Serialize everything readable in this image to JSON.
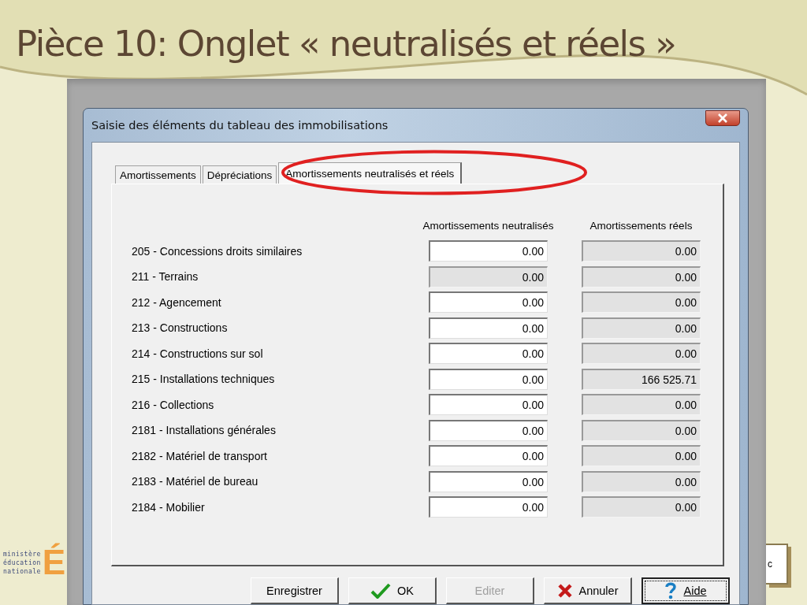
{
  "slide": {
    "title": "Pièce 10: Onglet « neutralisés et réels »",
    "logo": {
      "mark": "É",
      "lines": [
        "ministère",
        "éducation",
        "nationale"
      ]
    },
    "background_window": {
      "text": "c"
    }
  },
  "dialog": {
    "title": "Saisie des éléments du tableau des immobilisations",
    "tabs": [
      {
        "label": "Amortissements",
        "selected": false
      },
      {
        "label": "Dépréciations",
        "selected": false
      },
      {
        "label": "Amortissements neutralisés et réels",
        "selected": true
      }
    ],
    "columns": [
      "Amortissements neutralisés",
      "Amortissements réels"
    ],
    "rows": [
      {
        "label": "205 - Concessions droits similaires",
        "neutralises": {
          "value": "0.00",
          "disabled": false
        },
        "reels": {
          "value": "0.00",
          "disabled": true
        }
      },
      {
        "label": "211 - Terrains",
        "neutralises": {
          "value": "0.00",
          "disabled": true
        },
        "reels": {
          "value": "0.00",
          "disabled": true
        }
      },
      {
        "label": "212 - Agencement",
        "neutralises": {
          "value": "0.00",
          "disabled": false
        },
        "reels": {
          "value": "0.00",
          "disabled": true
        }
      },
      {
        "label": "213 - Constructions",
        "neutralises": {
          "value": "0.00",
          "disabled": false
        },
        "reels": {
          "value": "0.00",
          "disabled": true
        }
      },
      {
        "label": "214 - Constructions sur sol",
        "neutralises": {
          "value": "0.00",
          "disabled": false
        },
        "reels": {
          "value": "0.00",
          "disabled": true
        }
      },
      {
        "label": "215 - Installations techniques",
        "neutralises": {
          "value": "0.00",
          "disabled": false
        },
        "reels": {
          "value": "166 525.71",
          "disabled": true
        }
      },
      {
        "label": "216 - Collections",
        "neutralises": {
          "value": "0.00",
          "disabled": false
        },
        "reels": {
          "value": "0.00",
          "disabled": true
        }
      },
      {
        "label": "2181 - Installations générales",
        "neutralises": {
          "value": "0.00",
          "disabled": false
        },
        "reels": {
          "value": "0.00",
          "disabled": true
        }
      },
      {
        "label": "2182 - Matériel de transport",
        "neutralises": {
          "value": "0.00",
          "disabled": false
        },
        "reels": {
          "value": "0.00",
          "disabled": true
        }
      },
      {
        "label": "2183 - Matériel de bureau",
        "neutralises": {
          "value": "0.00",
          "disabled": false
        },
        "reels": {
          "value": "0.00",
          "disabled": true
        }
      },
      {
        "label": "2184 - Mobilier",
        "neutralises": {
          "value": "0.00",
          "disabled": false
        },
        "reels": {
          "value": "0.00",
          "disabled": true
        }
      }
    ],
    "buttons": [
      {
        "label": "Enregistrer",
        "kind": "plain",
        "disabled": false,
        "focused": false
      },
      {
        "label": "OK",
        "kind": "ok",
        "disabled": false,
        "focused": false
      },
      {
        "label": "Editer",
        "kind": "plain",
        "disabled": true,
        "focused": false
      },
      {
        "label": "Annuler",
        "kind": "cancel",
        "disabled": false,
        "focused": false
      },
      {
        "label": "Aide",
        "kind": "help",
        "disabled": false,
        "focused": true
      }
    ]
  }
}
